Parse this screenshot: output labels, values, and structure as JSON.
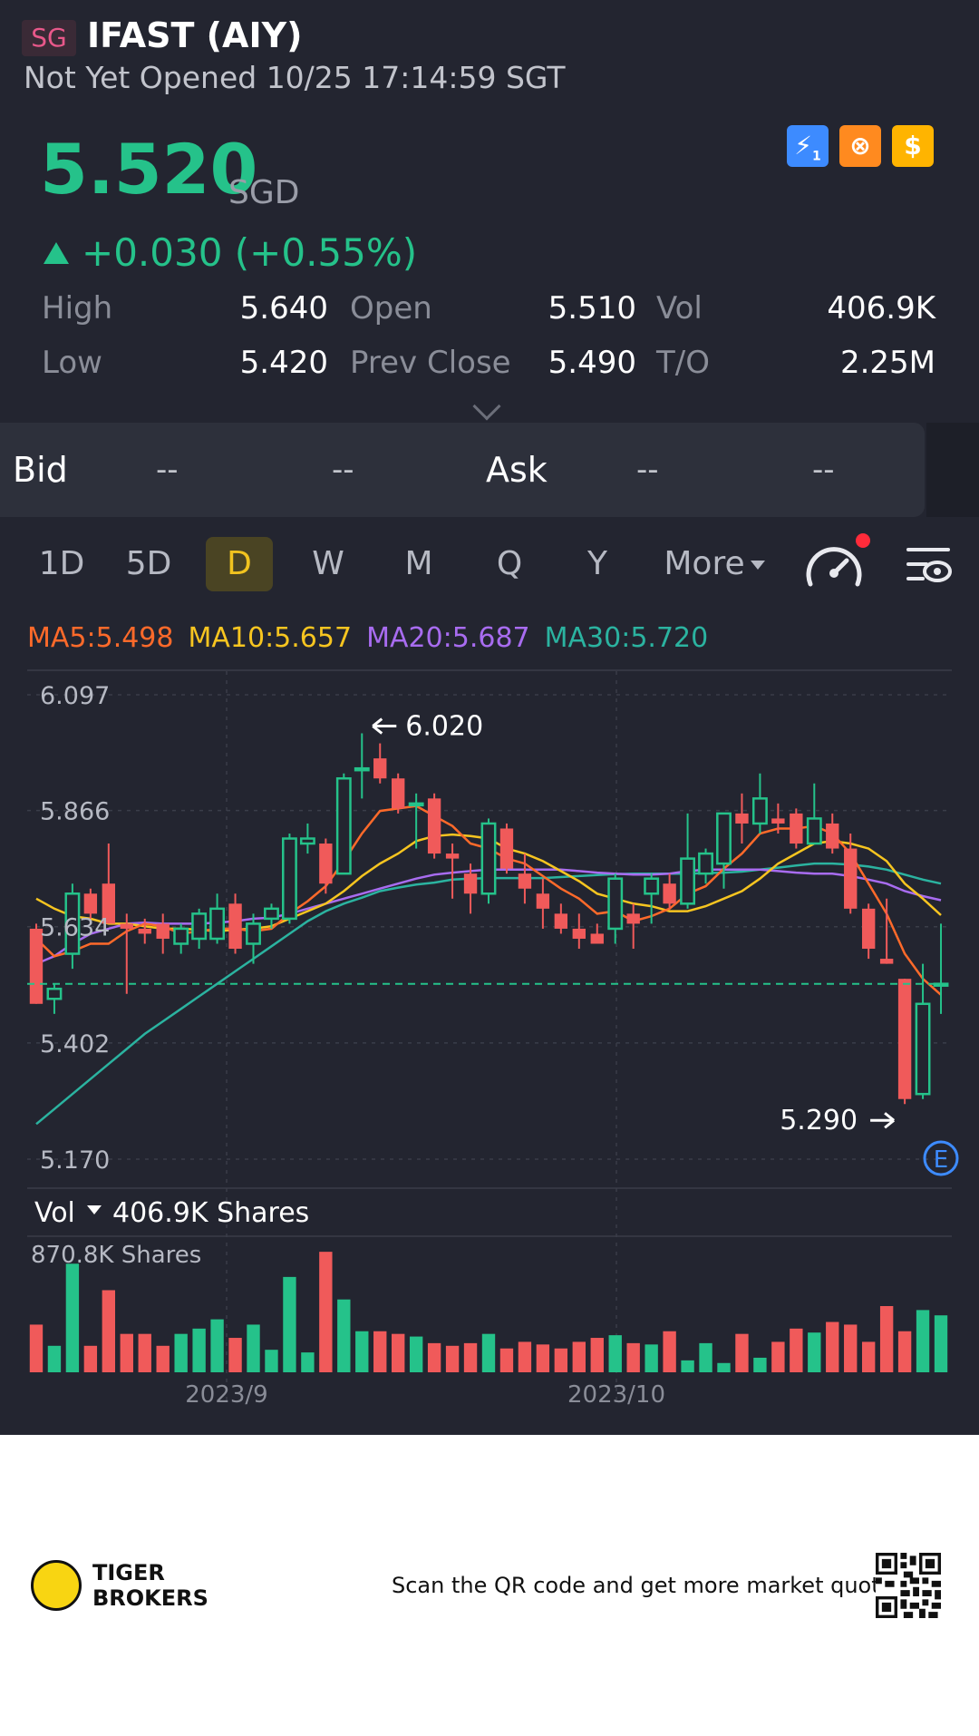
{
  "header": {
    "market": "SG",
    "ticker_name": "IFAST (AIY)",
    "status": "Not Yet Opened 10/25 17:14:59 SGT"
  },
  "quote": {
    "price": "5.520",
    "currency": "SGD",
    "change": "+0.030 (+0.55%)"
  },
  "badges": [
    {
      "icon": "lightning-level1-icon",
      "color": "#3d8bff",
      "glyph": "⚡"
    },
    {
      "icon": "options-swirl-icon",
      "color": "#ff8a1f",
      "glyph": "⊗"
    },
    {
      "icon": "dollar-icon",
      "color": "#ffb400",
      "glyph": "$"
    }
  ],
  "stats": {
    "high_label": "High",
    "high": "5.640",
    "open_label": "Open",
    "open": "5.510",
    "vol_label": "Vol",
    "vol": "406.9K",
    "low_label": "Low",
    "low": "5.420",
    "prev_close_label": "Prev Close",
    "prev_close": "5.490",
    "turnover_label": "T/O",
    "turnover": "2.25M"
  },
  "bidask": {
    "bid_label": "Bid",
    "bid_price": "--",
    "bid_size": "--",
    "ask_label": "Ask",
    "ask_price": "--",
    "ask_size": "--"
  },
  "tabs": [
    "1D",
    "5D",
    "D",
    "W",
    "M",
    "Q",
    "Y"
  ],
  "active_tab": "D",
  "more_label": "More",
  "ma": {
    "ma5": "MA5:5.498",
    "ma10": "MA10:5.657",
    "ma20": "MA20:5.687",
    "ma30": "MA30:5.720"
  },
  "colors": {
    "up": "#25c28a",
    "down": "#f05a5a",
    "ma5": "#ff6a2a",
    "ma10": "#f7c520",
    "ma20": "#a86cf0",
    "ma30": "#2bb3a0",
    "background": "#232530"
  },
  "chart_data": {
    "type": "candlestick",
    "y_ticks": [
      "6.097",
      "5.866",
      "5.634",
      "5.402",
      "5.170"
    ],
    "ylim": [
      5.17,
      6.097
    ],
    "x_ticks": [
      "2023/9",
      "2023/10"
    ],
    "last_price_line": 5.52,
    "annotations": {
      "high_label": "6.020",
      "low_label": "5.290"
    },
    "earnings_marker": "E",
    "candles": [
      {
        "o": 5.63,
        "h": 5.64,
        "l": 5.48,
        "c": 5.48
      },
      {
        "o": 5.49,
        "h": 5.52,
        "l": 5.46,
        "c": 5.51
      },
      {
        "o": 5.58,
        "h": 5.72,
        "l": 5.55,
        "c": 5.7
      },
      {
        "o": 5.7,
        "h": 5.71,
        "l": 5.65,
        "c": 5.66
      },
      {
        "o": 5.72,
        "h": 5.8,
        "l": 5.64,
        "c": 5.64
      },
      {
        "o": 5.64,
        "h": 5.66,
        "l": 5.5,
        "c": 5.63
      },
      {
        "o": 5.63,
        "h": 5.65,
        "l": 5.6,
        "c": 5.62
      },
      {
        "o": 5.64,
        "h": 5.66,
        "l": 5.58,
        "c": 5.61
      },
      {
        "o": 5.6,
        "h": 5.64,
        "l": 5.58,
        "c": 5.63
      },
      {
        "o": 5.61,
        "h": 5.67,
        "l": 5.59,
        "c": 5.66
      },
      {
        "o": 5.61,
        "h": 5.7,
        "l": 5.6,
        "c": 5.67
      },
      {
        "o": 5.68,
        "h": 5.7,
        "l": 5.58,
        "c": 5.59
      },
      {
        "o": 5.6,
        "h": 5.66,
        "l": 5.56,
        "c": 5.64
      },
      {
        "o": 5.65,
        "h": 5.68,
        "l": 5.63,
        "c": 5.67
      },
      {
        "o": 5.65,
        "h": 5.82,
        "l": 5.64,
        "c": 5.81
      },
      {
        "o": 5.8,
        "h": 5.84,
        "l": 5.78,
        "c": 5.81
      },
      {
        "o": 5.8,
        "h": 5.81,
        "l": 5.7,
        "c": 5.72
      },
      {
        "o": 5.74,
        "h": 5.94,
        "l": 5.74,
        "c": 5.93
      },
      {
        "o": 5.95,
        "h": 6.02,
        "l": 5.89,
        "c": 5.95
      },
      {
        "o": 5.97,
        "h": 6.0,
        "l": 5.92,
        "c": 5.93
      },
      {
        "o": 5.93,
        "h": 5.94,
        "l": 5.86,
        "c": 5.87
      },
      {
        "o": 5.88,
        "h": 5.9,
        "l": 5.79,
        "c": 5.88
      },
      {
        "o": 5.89,
        "h": 5.9,
        "l": 5.77,
        "c": 5.78
      },
      {
        "o": 5.78,
        "h": 5.8,
        "l": 5.69,
        "c": 5.77
      },
      {
        "o": 5.74,
        "h": 5.76,
        "l": 5.66,
        "c": 5.7
      },
      {
        "o": 5.7,
        "h": 5.85,
        "l": 5.68,
        "c": 5.84
      },
      {
        "o": 5.83,
        "h": 5.84,
        "l": 5.74,
        "c": 5.75
      },
      {
        "o": 5.74,
        "h": 5.78,
        "l": 5.68,
        "c": 5.71
      },
      {
        "o": 5.7,
        "h": 5.73,
        "l": 5.63,
        "c": 5.67
      },
      {
        "o": 5.66,
        "h": 5.68,
        "l": 5.62,
        "c": 5.63
      },
      {
        "o": 5.63,
        "h": 5.66,
        "l": 5.59,
        "c": 5.61
      },
      {
        "o": 5.62,
        "h": 5.64,
        "l": 5.6,
        "c": 5.6
      },
      {
        "o": 5.63,
        "h": 5.74,
        "l": 5.6,
        "c": 5.73
      },
      {
        "o": 5.66,
        "h": 5.68,
        "l": 5.59,
        "c": 5.64
      },
      {
        "o": 5.7,
        "h": 5.74,
        "l": 5.64,
        "c": 5.73
      },
      {
        "o": 5.72,
        "h": 5.74,
        "l": 5.67,
        "c": 5.68
      },
      {
        "o": 5.68,
        "h": 5.86,
        "l": 5.67,
        "c": 5.77
      },
      {
        "o": 5.74,
        "h": 5.79,
        "l": 5.72,
        "c": 5.78
      },
      {
        "o": 5.76,
        "h": 5.86,
        "l": 5.71,
        "c": 5.86
      },
      {
        "o": 5.86,
        "h": 5.9,
        "l": 5.8,
        "c": 5.84
      },
      {
        "o": 5.84,
        "h": 5.94,
        "l": 5.82,
        "c": 5.89
      },
      {
        "o": 5.85,
        "h": 5.88,
        "l": 5.82,
        "c": 5.84
      },
      {
        "o": 5.86,
        "h": 5.87,
        "l": 5.79,
        "c": 5.8
      },
      {
        "o": 5.8,
        "h": 5.92,
        "l": 5.8,
        "c": 5.85
      },
      {
        "o": 5.84,
        "h": 5.86,
        "l": 5.78,
        "c": 5.79
      },
      {
        "o": 5.79,
        "h": 5.82,
        "l": 5.66,
        "c": 5.67
      },
      {
        "o": 5.67,
        "h": 5.68,
        "l": 5.57,
        "c": 5.59
      },
      {
        "o": 5.57,
        "h": 5.69,
        "l": 5.56,
        "c": 5.56
      },
      {
        "o": 5.53,
        "h": 5.53,
        "l": 5.28,
        "c": 5.29
      },
      {
        "o": 5.3,
        "h": 5.56,
        "l": 5.29,
        "c": 5.48
      },
      {
        "o": 5.52,
        "h": 5.64,
        "l": 5.46,
        "c": 5.52
      }
    ],
    "ma5": [
      5.61,
      5.575,
      5.585,
      5.6,
      5.6,
      5.625,
      5.64,
      5.635,
      5.62,
      5.625,
      5.63,
      5.63,
      5.625,
      5.63,
      5.66,
      5.685,
      5.715,
      5.765,
      5.82,
      5.865,
      5.87,
      5.875,
      5.855,
      5.835,
      5.8,
      5.79,
      5.77,
      5.76,
      5.735,
      5.71,
      5.69,
      5.66,
      5.665,
      5.645,
      5.655,
      5.67,
      5.7,
      5.715,
      5.75,
      5.78,
      5.82,
      5.83,
      5.83,
      5.835,
      5.82,
      5.78,
      5.72,
      5.66,
      5.58,
      5.53,
      5.498
    ],
    "ma10": [
      5.69,
      5.67,
      5.655,
      5.65,
      5.64,
      5.64,
      5.635,
      5.63,
      5.63,
      5.628,
      5.625,
      5.628,
      5.63,
      5.635,
      5.65,
      5.665,
      5.68,
      5.705,
      5.735,
      5.76,
      5.78,
      5.805,
      5.815,
      5.818,
      5.815,
      5.81,
      5.79,
      5.78,
      5.765,
      5.745,
      5.725,
      5.7,
      5.69,
      5.68,
      5.675,
      5.665,
      5.665,
      5.675,
      5.69,
      5.705,
      5.73,
      5.76,
      5.78,
      5.8,
      5.805,
      5.8,
      5.79,
      5.765,
      5.72,
      5.69,
      5.657
    ],
    "ma20": [
      5.56,
      5.575,
      5.6,
      5.62,
      5.63,
      5.64,
      5.642,
      5.64,
      5.64,
      5.64,
      5.642,
      5.645,
      5.65,
      5.652,
      5.66,
      5.67,
      5.68,
      5.69,
      5.7,
      5.71,
      5.72,
      5.73,
      5.738,
      5.742,
      5.745,
      5.748,
      5.748,
      5.748,
      5.748,
      5.748,
      5.745,
      5.742,
      5.74,
      5.738,
      5.738,
      5.74,
      5.745,
      5.748,
      5.748,
      5.748,
      5.748,
      5.745,
      5.742,
      5.74,
      5.74,
      5.735,
      5.728,
      5.72,
      5.705,
      5.695,
      5.687
    ],
    "ma30": [
      5.24,
      5.27,
      5.3,
      5.33,
      5.36,
      5.39,
      5.42,
      5.445,
      5.47,
      5.495,
      5.52,
      5.545,
      5.57,
      5.595,
      5.62,
      5.645,
      5.665,
      5.68,
      5.692,
      5.705,
      5.712,
      5.718,
      5.722,
      5.728,
      5.73,
      5.731,
      5.731,
      5.731,
      5.731,
      5.733,
      5.735,
      5.737,
      5.739,
      5.74,
      5.74,
      5.74,
      5.74,
      5.741,
      5.742,
      5.744,
      5.748,
      5.752,
      5.756,
      5.76,
      5.76,
      5.758,
      5.754,
      5.748,
      5.738,
      5.728,
      5.72
    ],
    "volume": {
      "label": "Vol",
      "current": "406.9K Shares",
      "max_label": "870.8K Shares",
      "values": [
        0.36,
        0.2,
        0.82,
        0.2,
        0.62,
        0.29,
        0.29,
        0.2,
        0.29,
        0.33,
        0.4,
        0.26,
        0.36,
        0.17,
        0.72,
        0.15,
        0.91,
        0.55,
        0.31,
        0.31,
        0.29,
        0.27,
        0.22,
        0.2,
        0.22,
        0.29,
        0.18,
        0.23,
        0.21,
        0.18,
        0.23,
        0.26,
        0.28,
        0.22,
        0.21,
        0.31,
        0.09,
        0.22,
        0.07,
        0.29,
        0.11,
        0.23,
        0.33,
        0.3,
        0.38,
        0.36,
        0.23,
        0.5,
        0.31,
        0.47,
        0.43
      ]
    }
  },
  "footer": {
    "brand_line1": "TIGER",
    "brand_line2": "BROKERS",
    "scan_text": "Scan the QR code and get more market quotes"
  }
}
